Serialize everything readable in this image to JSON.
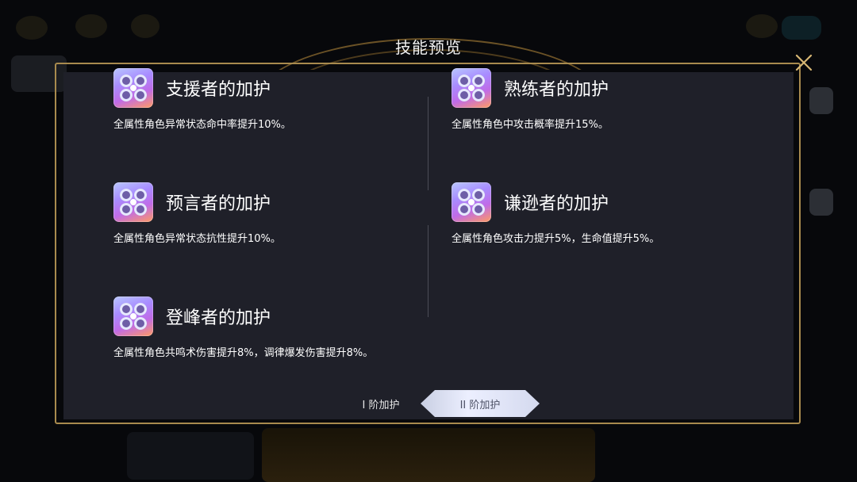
{
  "dialog": {
    "title": "技能预览"
  },
  "skills": [
    {
      "name": "支援者的加护",
      "desc": "全属性角色异常状态命中率提升10%。"
    },
    {
      "name": "熟练者的加护",
      "desc": "全属性角色中攻击概率提升15%。"
    },
    {
      "name": "预言者的加护",
      "desc": "全属性角色异常状态抗性提升10%。"
    },
    {
      "name": "谦逊者的加护",
      "desc": "全属性角色攻击力提升5%，生命值提升5%。"
    },
    {
      "name": "登峰者的加护",
      "desc": "全属性角色共鸣术伤害提升8%，调律爆发伤害提升8%。"
    }
  ],
  "tabs": [
    {
      "label": "I 阶加护",
      "active": false
    },
    {
      "label": "II 阶加护",
      "active": true
    }
  ],
  "colors": {
    "frame": "#a88a4e",
    "panel": "#1f2029",
    "active_tab": "#e3e7f7"
  },
  "icons": {
    "close": "close-icon",
    "skill": "skill-icon"
  }
}
